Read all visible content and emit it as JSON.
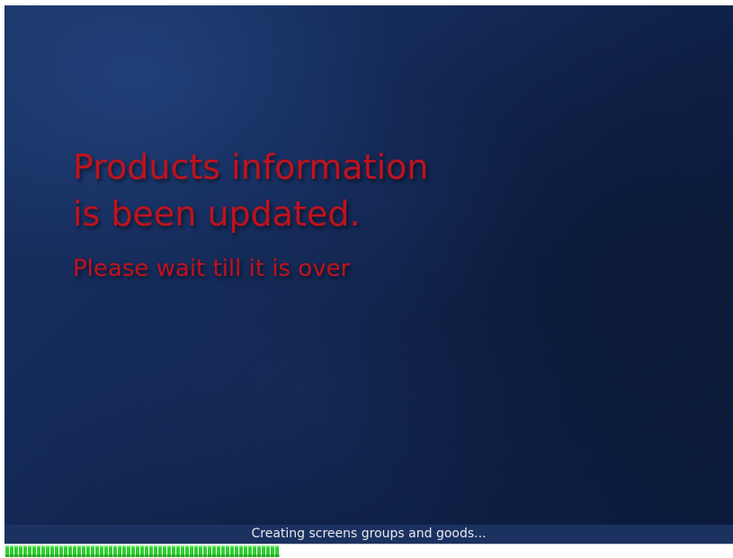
{
  "splash": {
    "headline_line1": "Products information",
    "headline_line2": "is been updated.",
    "subline": "Please wait till it is over"
  },
  "status": {
    "message": "Creating screens groups and goods..."
  },
  "progress": {
    "fraction": 0.375
  },
  "colors": {
    "headline_text": "#c1121c",
    "background": "#142a58",
    "status_bar_background": "#1b3160",
    "progress_fill": "#2fcf2f"
  }
}
